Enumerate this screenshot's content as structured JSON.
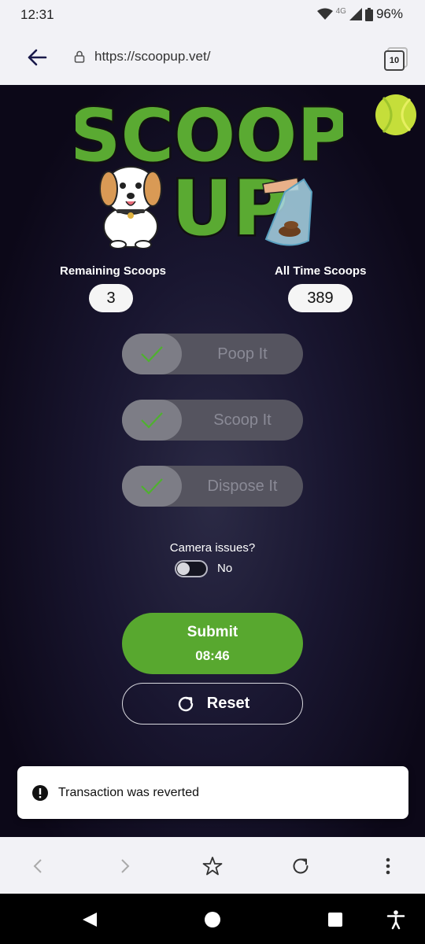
{
  "status_bar": {
    "time": "12:31",
    "network": "4G",
    "battery": "96%"
  },
  "browser": {
    "url": "https://scoopup.vet/",
    "tab_count": "10"
  },
  "stats": {
    "remaining_label": "Remaining Scoops",
    "remaining_value": "3",
    "alltime_label": "All Time Scoops",
    "alltime_value": "389"
  },
  "steps": [
    {
      "label": "Poop It",
      "checked": true
    },
    {
      "label": "Scoop It",
      "checked": true
    },
    {
      "label": "Dispose It",
      "checked": true
    }
  ],
  "camera": {
    "label": "Camera issues?",
    "state": "No",
    "enabled": false
  },
  "submit": {
    "label": "Submit",
    "timer": "08:46"
  },
  "reset": {
    "label": "Reset"
  },
  "toast": {
    "message": "Transaction was reverted"
  },
  "colors": {
    "brand_green": "#58a82f",
    "page_bg": "#191630",
    "logo_green": "#5aaa32"
  },
  "icons": [
    "back-arrow-icon",
    "lock-icon",
    "tabs-icon",
    "tennis-ball-icon",
    "checkmark-icon",
    "reset-icon",
    "info-icon",
    "forward-icon",
    "star-icon",
    "reload-icon",
    "more-icon",
    "home-icon",
    "recents-icon",
    "accessibility-icon"
  ]
}
